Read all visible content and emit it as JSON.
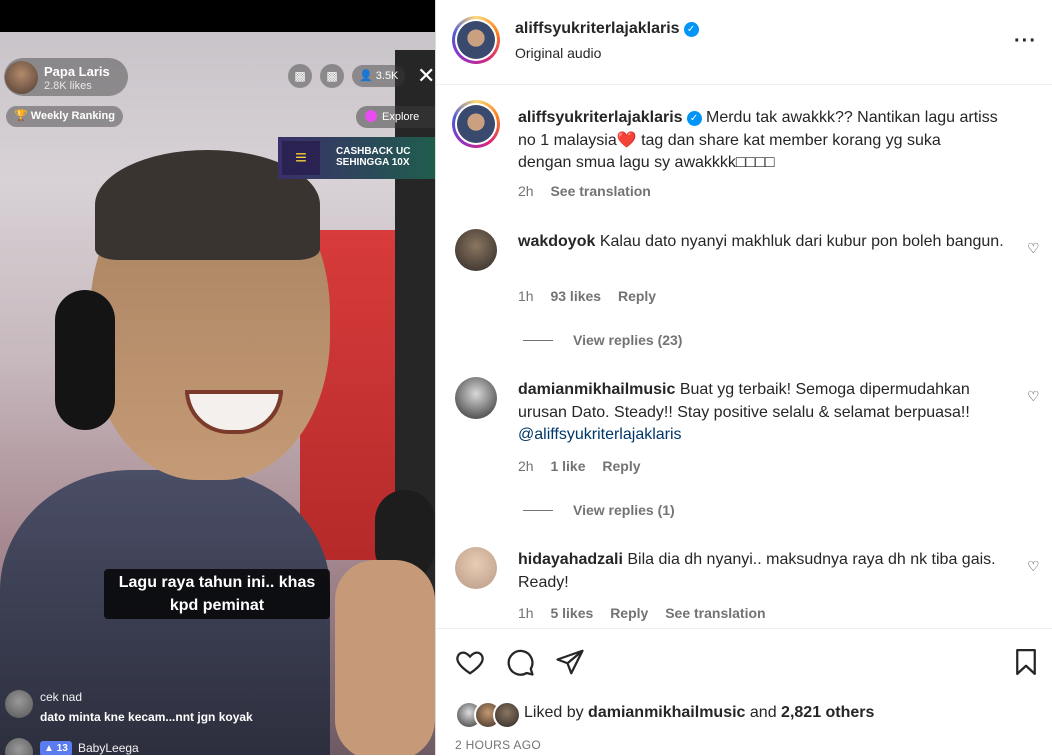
{
  "media": {
    "host_name": "Papa Laris",
    "host_likes": "2.8K likes",
    "viewer_count": "3.5K",
    "weekly_ranking": "Weekly Ranking",
    "explore_label": "Explore",
    "cashback_text": "CASHBACK UC SEHINGGA 10X",
    "video_caption_line1": "Lagu raya tahun ini.. khas",
    "video_caption_line2": "kpd peminat",
    "chat": [
      {
        "user": "cek nad",
        "text": "dato minta kne kecam...nnt jgn koyak"
      },
      {
        "user": "BabyLeega",
        "badge": "13"
      }
    ]
  },
  "post": {
    "username": "aliffsyukriterlajaklaris",
    "audio": "Original audio",
    "caption": "Merdu tak awakkk?? Nantikan lagu artiss no 1 malaysia❤️ tag dan share kat member korang yg suka dengan smua lagu sy awakkkk□□□□",
    "caption_time": "2h",
    "see_translation": "See translation"
  },
  "comments": [
    {
      "user": "wakdoyok",
      "text": "Kalau dato nyanyi makhluk dari kubur pon boleh bangun.",
      "time": "1h",
      "likes": "93 likes",
      "reply": "Reply",
      "view_replies": "View replies (23)"
    },
    {
      "user": "damianmikhailmusic",
      "text": "Buat yg terbaik! Semoga dipermudahkan urusan Dato. Steady!! Stay positive selalu & selamat berpuasa!!",
      "mention": "@aliffsyukriterlajaklaris",
      "time": "2h",
      "likes": "1 like",
      "reply": "Reply",
      "view_replies": "View replies (1)"
    },
    {
      "user": "hidayahadzali",
      "text": "Bila dia dh nyanyi.. maksudnya raya dh nk tiba gais. Ready!",
      "time": "1h",
      "likes": "5 likes",
      "reply": "Reply",
      "see_translation": "See translation"
    }
  ],
  "actions": {
    "liked_by_prefix": "Liked by",
    "liked_by_user": "damianmikhailmusic",
    "liked_by_and": "and",
    "liked_by_others": "2,821 others",
    "timestamp": "2 HOURS AGO"
  },
  "icons": {
    "like": "heart-icon",
    "comment": "comment-bubble-icon",
    "share": "paper-plane-icon",
    "save": "bookmark-icon",
    "more": "more-options-icon",
    "verified": "verified-badge-icon"
  },
  "colors": {
    "verified": "#0095f6",
    "text_primary": "#262626",
    "text_secondary": "#737373"
  }
}
